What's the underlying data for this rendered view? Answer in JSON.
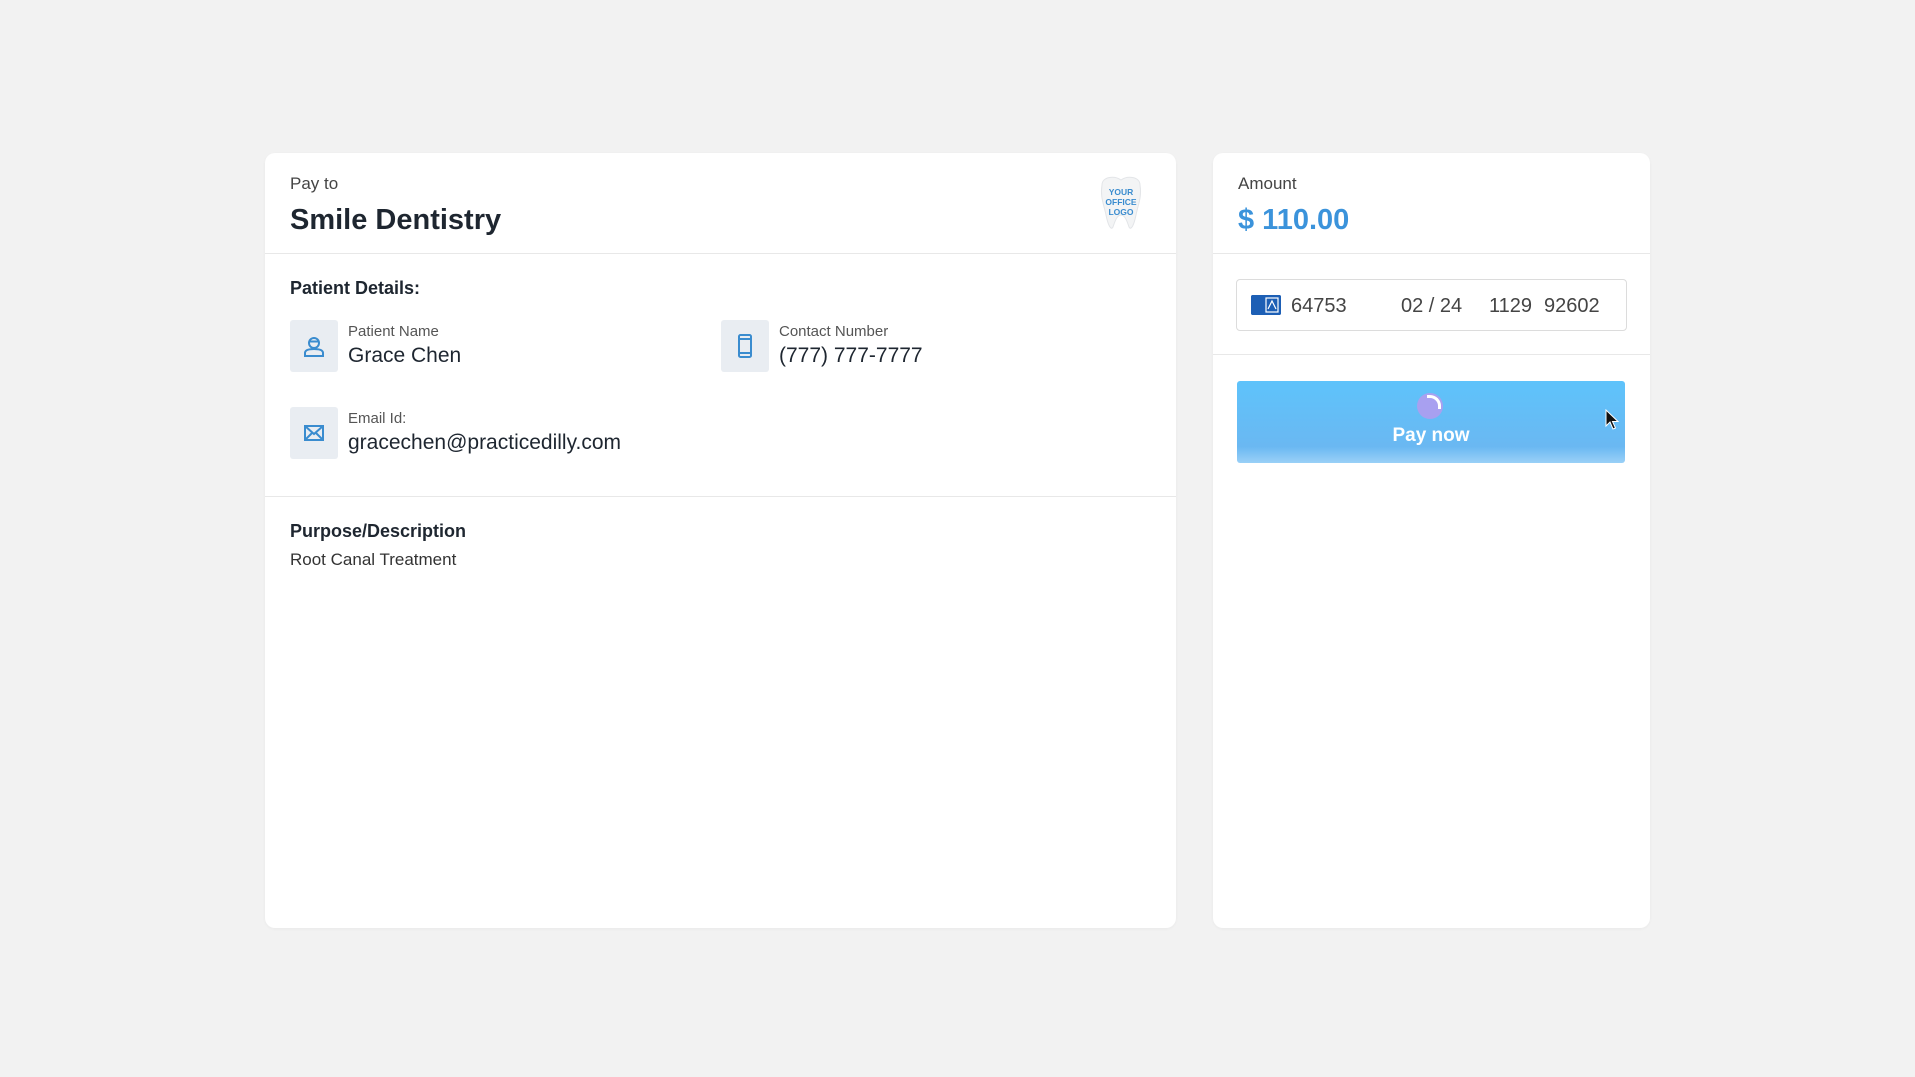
{
  "payee": {
    "label": "Pay to",
    "name": "Smile Dentistry",
    "logo_text": "YOUR OFFICE LOGO",
    "logo_icon": "tooth-logo-icon"
  },
  "patient": {
    "section_title": "Patient Details:",
    "name_label": "Patient Name",
    "name_value": "Grace Chen",
    "contact_label": "Contact Number",
    "contact_value": "(777) 777-7777",
    "email_label": "Email Id:",
    "email_value": "gracechen@practicedilly.com"
  },
  "purpose": {
    "title": "Purpose/Description",
    "value": "Root Canal Treatment"
  },
  "amount": {
    "label": "Amount",
    "value": "$ 110.00"
  },
  "card_input": {
    "brand_icon": "amex-card-icon",
    "number": "64753",
    "expiry": "02 / 24",
    "cvc": "1129",
    "zip": "92602"
  },
  "pay_button": {
    "label": "Pay now",
    "state": "loading"
  },
  "colors": {
    "background": "#f2f2f2",
    "accent": "#3b93db",
    "button": "#5ec3fb",
    "icon_box": "#e9edf2"
  }
}
